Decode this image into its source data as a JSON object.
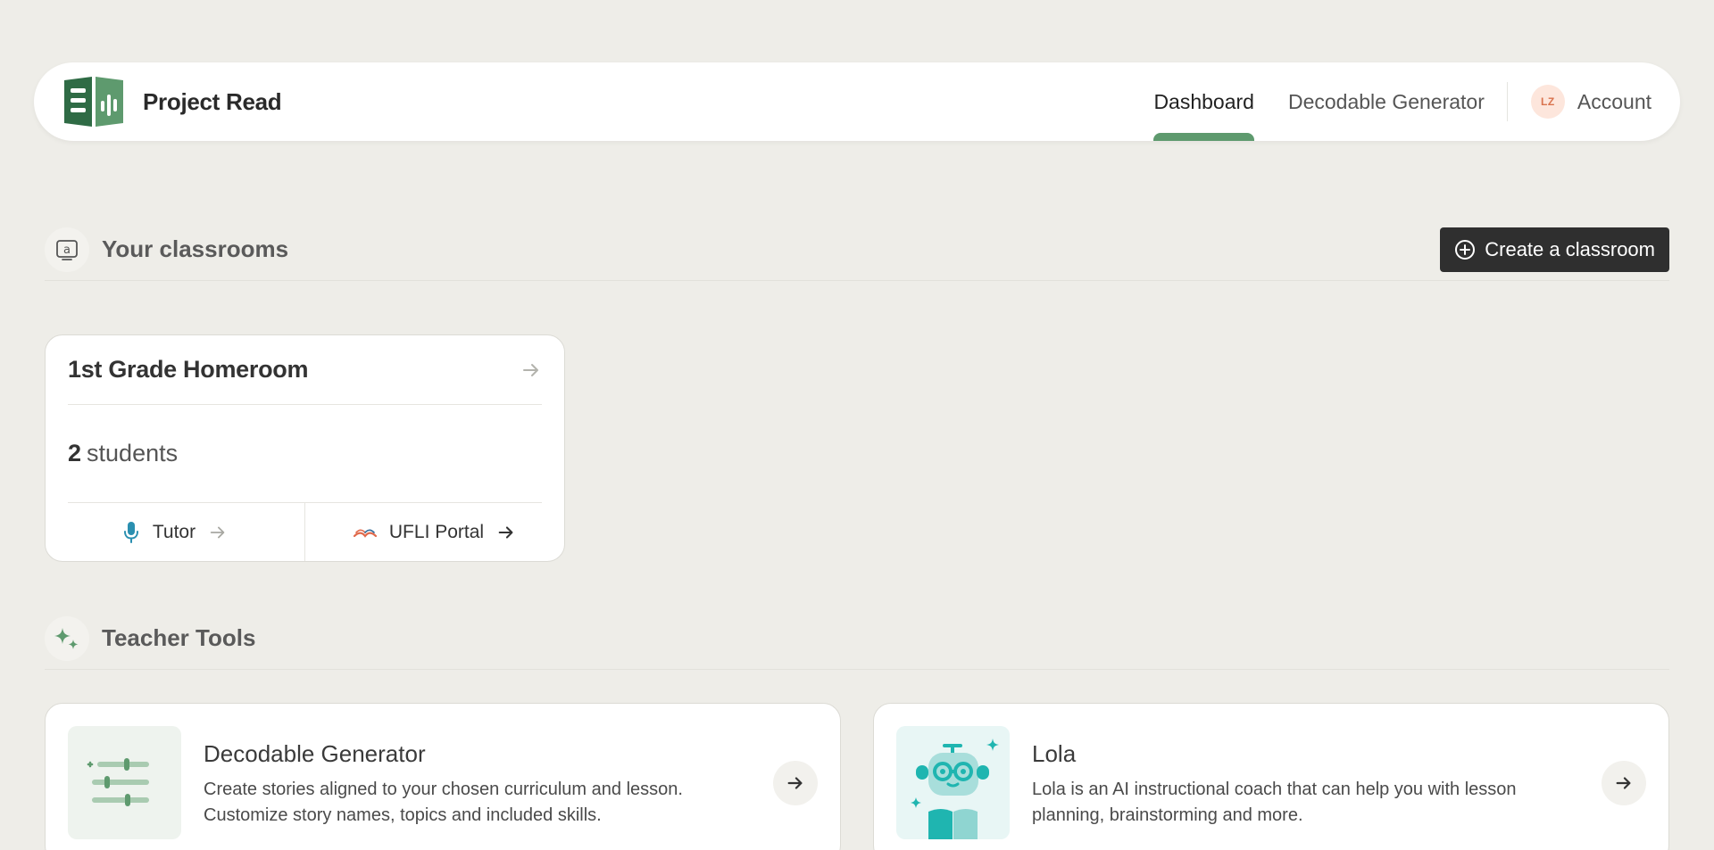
{
  "header": {
    "brand_name": "Project Read",
    "nav": [
      {
        "label": "Dashboard",
        "active": true
      },
      {
        "label": "Decodable Generator",
        "active": false
      }
    ],
    "account": {
      "initials": "LZ",
      "label": "Account"
    }
  },
  "classrooms": {
    "title": "Your classrooms",
    "create_label": "Create a classroom",
    "cards": [
      {
        "name": "1st Grade Homeroom",
        "student_count": "2",
        "student_label": "students",
        "actions": [
          {
            "label": "Tutor",
            "icon": "microphone-icon"
          },
          {
            "label": "UFLI Portal",
            "icon": "ufli-book-icon"
          }
        ]
      }
    ]
  },
  "tools": {
    "title": "Teacher Tools",
    "items": [
      {
        "title": "Decodable Generator",
        "description": "Create stories aligned to your chosen curriculum and lesson. Customize story names, topics and included skills.",
        "icon": "sliders-icon"
      },
      {
        "title": "Lola",
        "description": "Lola is an AI instructional coach that can help you with lesson planning, brainstorming and more.",
        "icon": "robot-icon"
      }
    ]
  },
  "colors": {
    "accent_green": "#5e9a6e",
    "background": "#eeede8",
    "teal": "#1fb5b0",
    "button_dark": "#2f2f2f"
  }
}
